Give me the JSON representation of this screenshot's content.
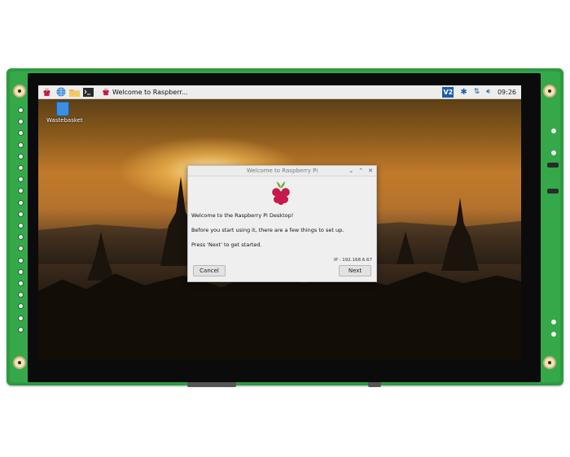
{
  "taskbar": {
    "window_button_label": "Welcome to Raspberr...",
    "vnc_label": "V2",
    "clock": "09:26",
    "icons": [
      "raspberry-menu-icon",
      "web-browser-icon",
      "file-manager-icon",
      "terminal-icon"
    ],
    "tray_icons": [
      "vnc-icon",
      "bluetooth-icon",
      "network-icon",
      "volume-icon"
    ]
  },
  "desktop": {
    "icon_label": "Wastebasket"
  },
  "dialog": {
    "title": "Welcome to Raspberry Pi",
    "heading": "Welcome to the Raspberry Pi Desktop!",
    "body": "Before you start using it, there are a few things to set up.",
    "prompt": "Press 'Next' to get started.",
    "ip": "IP : 192.168.6.67",
    "cancel_label": "Cancel",
    "next_label": "Next",
    "controls": [
      "minimize-icon",
      "maximize-icon",
      "close-icon"
    ]
  },
  "colors": {
    "board_green": "#2f9a41",
    "taskbar": "#ededed",
    "raspberry_red": "#c51a4a",
    "leaf_green": "#75a928",
    "vnc_blue": "#1b5fa8"
  }
}
